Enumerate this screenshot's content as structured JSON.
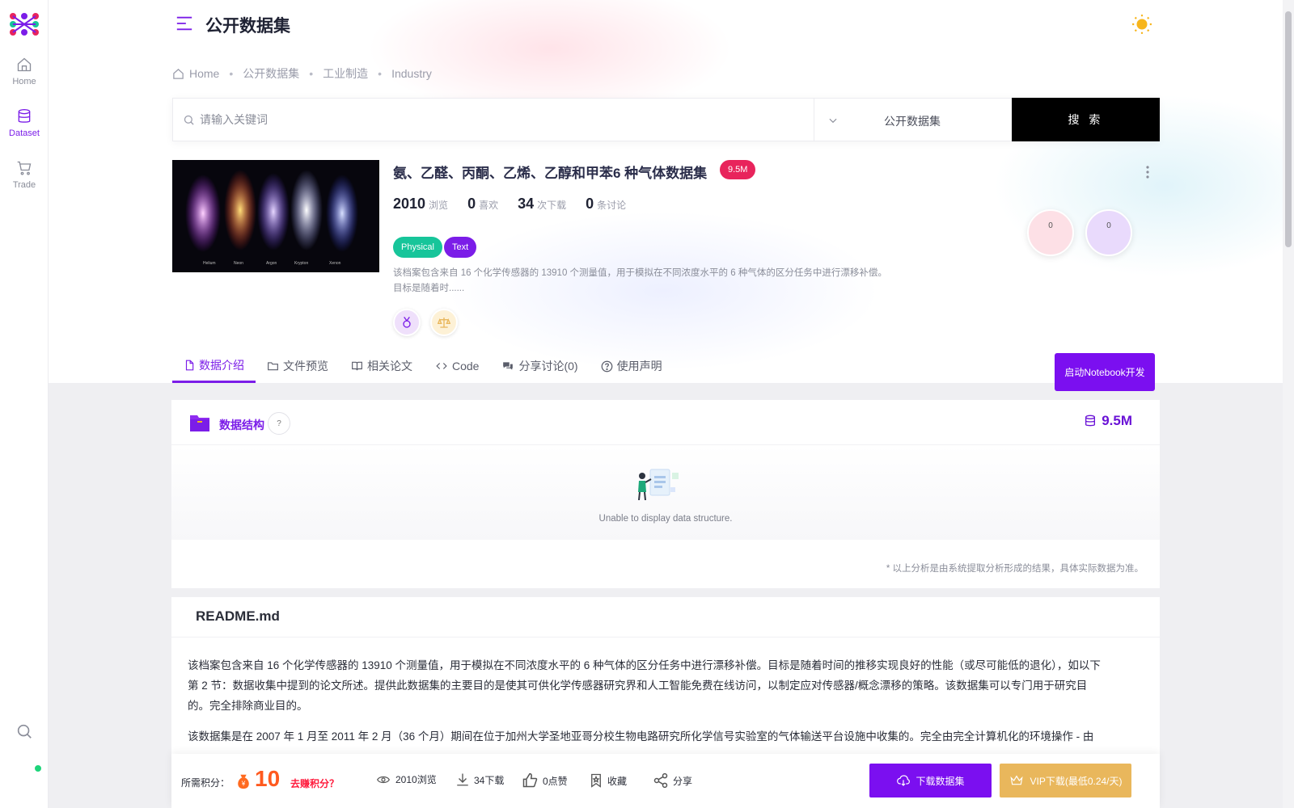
{
  "sidebar": {
    "items": [
      {
        "label": "Home",
        "icon": "home-icon"
      },
      {
        "label": "Dataset",
        "icon": "database-icon"
      },
      {
        "label": "Trade",
        "icon": "cart-icon"
      }
    ],
    "active_color": "#7b1de8"
  },
  "header": {
    "title": "公开数据集"
  },
  "breadcrumb": [
    "Home",
    "公开数据集",
    "工业制造",
    "Industry"
  ],
  "search": {
    "placeholder": "请输入关键词",
    "scope": "公开数据集",
    "button": "搜 索"
  },
  "dataset": {
    "title": "氨、乙醛、丙酮、乙烯、乙醇和甲苯6 种气体数据集",
    "size_badge": "9.5M",
    "stats": [
      {
        "num": "2010",
        "label": "浏览"
      },
      {
        "num": "0",
        "label": "喜欢"
      },
      {
        "num": "34",
        "label": "次下载"
      },
      {
        "num": "0",
        "label": "条讨论"
      }
    ],
    "tags": [
      {
        "label": "Physical",
        "color": "#17c59a"
      },
      {
        "label": "Text",
        "color": "#7b1de8"
      }
    ],
    "desc_line1": "该档案包含来自 16 个化学传感器的 13910 个测量值，用于模拟在不同浓度水平的 6 种气体的区分任务中进行漂移补偿。",
    "desc_line2": "目标是随着时......",
    "thumbnail_labels": [
      "Helium",
      "Neon",
      "Argon",
      "Krypton",
      "Xenon"
    ],
    "circle_a": "0",
    "circle_b": "0"
  },
  "tabs": [
    "数据介绍",
    "文件预览",
    "相关论文",
    "Code",
    "分享讨论(0)",
    "使用声明"
  ],
  "notebook_button": "启动Notebook开发",
  "data_structure": {
    "title": "数据结构",
    "help": "?",
    "size": "9.5M",
    "empty_text": "Unable to display data structure.",
    "note": "* 以上分析是由系统提取分析形成的结果，具体实际数据为准。"
  },
  "readme": {
    "title": "README.md",
    "p1_l1": "该档案包含来自 16 个化学传感器的 13910 个测量值，用于模拟在不同浓度水平的 6 种气体的区分任务中进行漂移补偿。目标是随着时间的推移实现良好的性能（或尽可能低的退化），如以下",
    "p1_l2": "第 2 节：数据收集中提到的论文所述。提供此数据集的主要目的是使其可供化学传感器研究界和人工智能免费在线访问，以制定应对传感器/概念漂移的策略。该数据集可以专门用于研究目",
    "p1_l3": "的。完全排除商业目的。",
    "p2": "该数据集是在 2007 年 1 月至 2011 年 2 月（36 个月）期间在位于加州大学圣地亚哥分校生物电路研究所化学信号实验室的气体输送平台设施中收集的。完全由完全计算机化的环境操作 - 由"
  },
  "bottom_bar": {
    "points_label": "所需积分：",
    "points": "10",
    "earn": "去赚积分？",
    "views": "2010浏览",
    "downloads": "34下载",
    "likes": "0点赞",
    "favorite": "收藏",
    "share": "分享",
    "download_btn": "下载数据集",
    "vip_btn": "VIP下载(最低0.24/天)"
  },
  "colors": {
    "accent": "#7b1de8",
    "badge": "#e8245c",
    "vip": "#e9b75c",
    "points": "#ff5a1f"
  }
}
